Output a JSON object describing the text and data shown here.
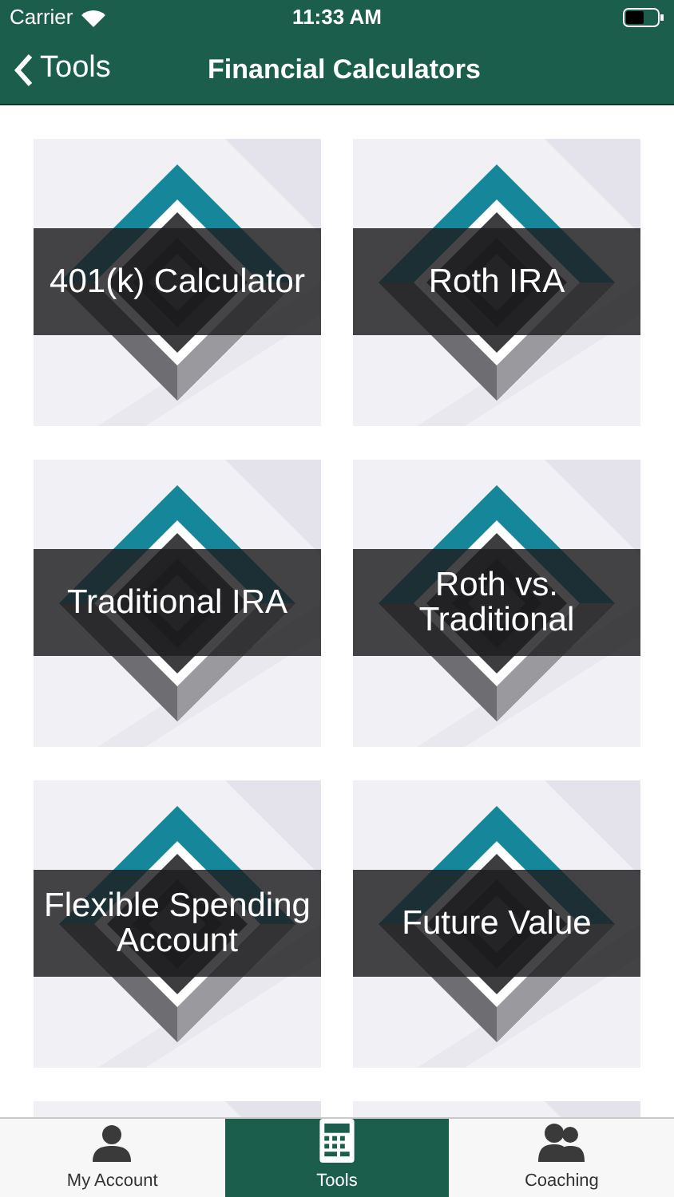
{
  "status_bar": {
    "carrier": "Carrier",
    "time": "11:33 AM"
  },
  "nav_bar": {
    "back": "Tools",
    "title": "Financial Calculators"
  },
  "tiles": [
    {
      "kind": "calculator",
      "label": "401(k) Calculator"
    },
    {
      "kind": "calculator",
      "label": "Roth IRA"
    },
    {
      "kind": "calculator",
      "label": "Traditional IRA"
    },
    {
      "kind": "calculator",
      "label": "Roth vs. Traditional"
    },
    {
      "kind": "calculator",
      "label": "Flexible Spending Account"
    },
    {
      "kind": "calculator",
      "label": "Future Value"
    },
    {
      "kind": "picture"
    },
    {
      "kind": "picture"
    }
  ],
  "tab_bar": [
    {
      "label": "My Account",
      "selected": false
    },
    {
      "label": "Tools",
      "selected": true
    },
    {
      "label": "Coaching",
      "selected": false
    }
  ]
}
